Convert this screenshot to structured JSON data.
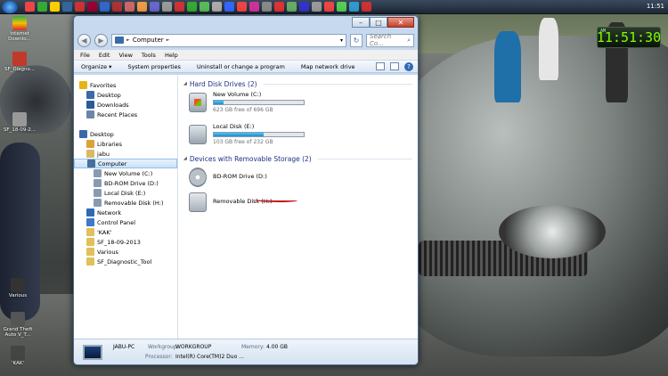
{
  "taskbar": {
    "clock": "11:51"
  },
  "desktop_icons": [
    {
      "label": "Internet Downlo...",
      "color": "#2a6bc0"
    },
    {
      "label": "SF_Diagno...",
      "color": "#c0392b"
    },
    {
      "label": "SF_18-09-2...",
      "color": "#888888"
    },
    {
      "label": "Various",
      "color": "#444444"
    },
    {
      "label": "Grand Theft Auto V_T...",
      "color": "#666666"
    },
    {
      "label": "'KAK'",
      "color": "#555555"
    }
  ],
  "clock_gadget": {
    "ampm": "AM",
    "time": "11:51:30"
  },
  "window": {
    "address": "Computer",
    "address_sep": "►",
    "search_placeholder": "Search Co...",
    "menu": [
      "File",
      "Edit",
      "View",
      "Tools",
      "Help"
    ],
    "commands": [
      "Organize ▾",
      "System properties",
      "Uninstall or change a program",
      "Map network drive"
    ],
    "nav": [
      {
        "label": "Favorites",
        "icon": "star-icon",
        "indent": 0,
        "color": "#e7b416",
        "selected": false
      },
      {
        "label": "Desktop",
        "icon": "desktop-icon",
        "indent": 1,
        "color": "#3b6aa8",
        "selected": false
      },
      {
        "label": "Downloads",
        "icon": "downloads-icon",
        "indent": 1,
        "color": "#2b5a99",
        "selected": false
      },
      {
        "label": "Recent Places",
        "icon": "recent-places-icon",
        "indent": 1,
        "color": "#6b86a8",
        "selected": false
      },
      {
        "label": "",
        "icon": "",
        "indent": 0,
        "color": "",
        "selected": false
      },
      {
        "label": "Desktop",
        "icon": "desktop-icon",
        "indent": 0,
        "color": "#3b6aa8",
        "selected": false
      },
      {
        "label": "Libraries",
        "icon": "libraries-icon",
        "indent": 1,
        "color": "#d9a23b",
        "selected": false
      },
      {
        "label": "jabu",
        "icon": "user-folder-icon",
        "indent": 1,
        "color": "#d9b86a",
        "selected": false
      },
      {
        "label": "Computer",
        "icon": "computer-icon",
        "indent": 1,
        "color": "#4b6f9c",
        "selected": true
      },
      {
        "label": "New Volume (C:)",
        "icon": "drive-icon",
        "indent": 2,
        "color": "#8a9bb0",
        "selected": false
      },
      {
        "label": "BD-ROM Drive (D:)",
        "icon": "disc-drive-icon",
        "indent": 2,
        "color": "#8a9bb0",
        "selected": false
      },
      {
        "label": "Local Disk (E:)",
        "icon": "drive-icon",
        "indent": 2,
        "color": "#8a9bb0",
        "selected": false
      },
      {
        "label": "Removable Disk (H:)",
        "icon": "removable-drive-icon",
        "indent": 2,
        "color": "#8a9bb0",
        "selected": false
      },
      {
        "label": "Network",
        "icon": "network-icon",
        "indent": 1,
        "color": "#2f6ab3",
        "selected": false
      },
      {
        "label": "Control Panel",
        "icon": "control-panel-icon",
        "indent": 1,
        "color": "#3d7ac7",
        "selected": false
      },
      {
        "label": "'KAK'",
        "icon": "folder-icon",
        "indent": 1,
        "color": "#e2c05a",
        "selected": false
      },
      {
        "label": "SF_18-09-2013",
        "icon": "folder-icon",
        "indent": 1,
        "color": "#e2c05a",
        "selected": false
      },
      {
        "label": "Various",
        "icon": "folder-icon",
        "indent": 1,
        "color": "#e2c05a",
        "selected": false
      },
      {
        "label": "SF_Diagnostic_Tool",
        "icon": "folder-icon",
        "indent": 1,
        "color": "#e2c05a",
        "selected": false
      }
    ],
    "groups": [
      {
        "title": "Hard Disk Drives (2)",
        "drives": [
          {
            "name": "New Volume (C:)",
            "free": "623 GB free of 696 GB",
            "used_fraction": 0.105,
            "icon": "hard-drive-icon"
          },
          {
            "name": "Local Disk (E:)",
            "free": "103 GB free of 232 GB",
            "used_fraction": 0.556,
            "icon": "hard-drive-icon"
          }
        ]
      },
      {
        "title": "Devices with Removable Storage (2)",
        "drives": [
          {
            "name": "BD-ROM Drive (D:)",
            "free": "",
            "used_fraction": null,
            "icon": "disc-drive-icon"
          },
          {
            "name": "Removable Disk (H:)",
            "free": "",
            "used_fraction": null,
            "icon": "removable-drive-icon"
          }
        ]
      }
    ],
    "details": {
      "pc_name": "JABU-PC",
      "workgroup_label": "Workgroup:",
      "workgroup": "WORKGROUP",
      "memory_label": "Memory:",
      "memory": "4.00 GB",
      "processor_label": "Processor:",
      "processor": "Intel(R) Core(TM)2 Duo ..."
    }
  }
}
